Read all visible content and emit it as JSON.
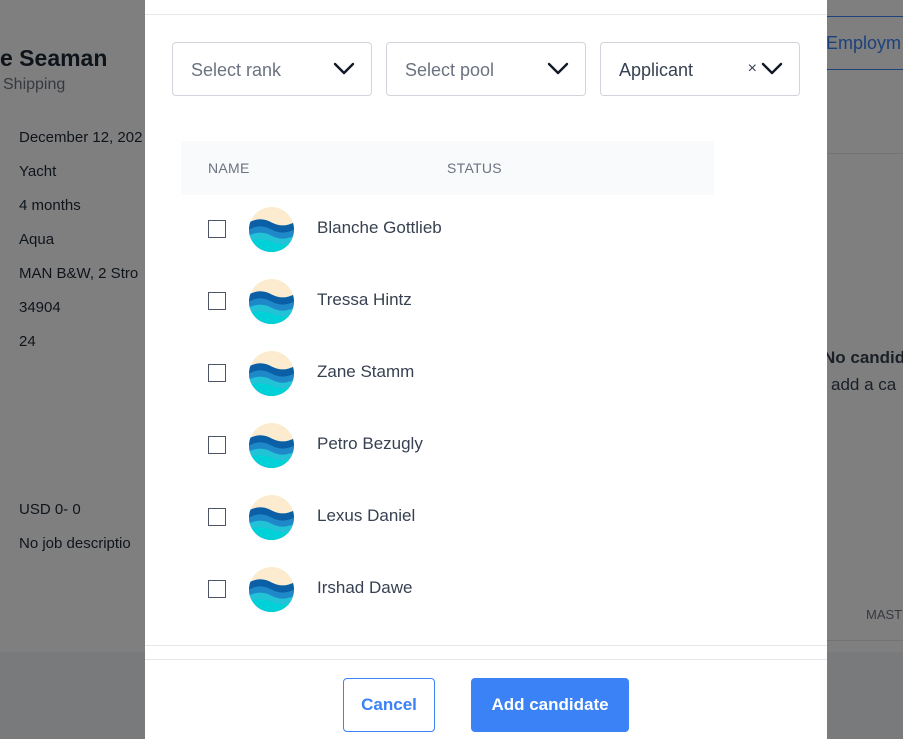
{
  "background": {
    "title": "e Seaman",
    "subtitle": "Shipping",
    "details": [
      "December 12, 202",
      "Yacht",
      "4 months",
      "Aqua",
      "MAN B&W, 2 Stro",
      "34904",
      "24"
    ],
    "salary": "USD 0- 0",
    "job_description": "No job descriptio",
    "employment_button": "Employm",
    "no_candidates": "No candid",
    "add_candidate_hint": "add a ca",
    "column_master": "MASTE"
  },
  "modal": {
    "filters": {
      "rank": {
        "placeholder": "Select rank"
      },
      "pool": {
        "placeholder": "Select pool"
      },
      "status": {
        "value": "Applicant",
        "clear": "×"
      }
    },
    "table": {
      "columns": [
        "NAME",
        "STATUS"
      ],
      "rows": [
        {
          "name": "Blanche Gottlieb"
        },
        {
          "name": "Tressa Hintz"
        },
        {
          "name": "Zane Stamm"
        },
        {
          "name": "Petro Bezugly"
        },
        {
          "name": "Lexus Daniel"
        },
        {
          "name": "Irshad Dawe"
        }
      ]
    },
    "buttons": {
      "cancel": "Cancel",
      "add": "Add candidate"
    }
  },
  "icons": {
    "chevron": "chevron-down-icon",
    "avatar": "wave-avatar-icon"
  },
  "colors": {
    "accent": "#3b82f6",
    "overlay": "rgba(0,0,0,0.5)"
  }
}
